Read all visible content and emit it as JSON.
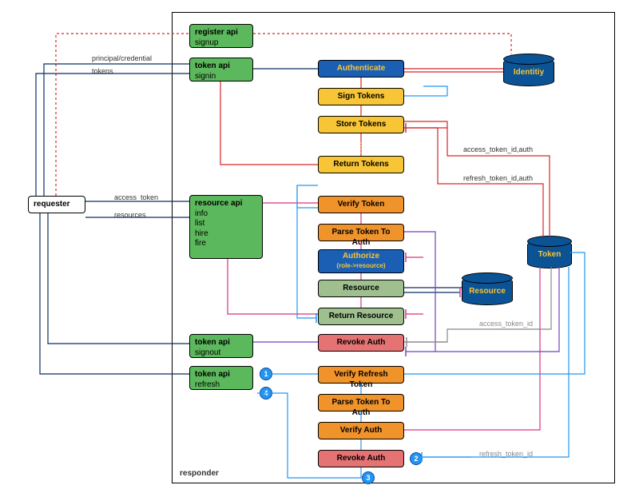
{
  "requester": {
    "label": "requester",
    "edge_out_top": "principal/credential",
    "edge_out_bottom": "tokens",
    "edge_in_top": "access_token",
    "edge_in_bottom": "resources"
  },
  "responder_label": "responder",
  "apis": {
    "register": {
      "title": "register api",
      "sub": "signup"
    },
    "token_signin": {
      "title": "token api",
      "sub": "signin"
    },
    "resource": {
      "title": "resource api",
      "subs": [
        "info",
        "list",
        "hire",
        "fire"
      ]
    },
    "token_signout": {
      "title": "token api",
      "sub": "signout"
    },
    "token_refresh": {
      "title": "token api",
      "sub": "refresh"
    }
  },
  "pipeline": {
    "authenticate": "Authenticate",
    "sign_tokens": "Sign Tokens",
    "store_tokens": "Store Tokens",
    "return_tokens": "Return Tokens",
    "verify_token": "Verify Token",
    "parse_token": "Parse Token To Auth",
    "authorize": {
      "title": "Authorize",
      "sub": "(role->resource)"
    },
    "resource": "Resource",
    "return_resource": "Return Resource",
    "revoke_auth_1": "Revoke Auth",
    "verify_refresh": "Verify Refresh Token",
    "parse_token_2": "Parse Token To Auth",
    "verify_auth": "Verify Auth",
    "revoke_auth_2": "Revoke Auth"
  },
  "stores": {
    "identity": "Identitiy",
    "token": "Token",
    "resource": "Resource"
  },
  "annotations": {
    "access_token_id_auth": "access_token_id,auth",
    "refresh_token_id_auth": "refresh_token_id,auth",
    "access_token_id": "access_token_id",
    "refresh_token_id": "refresh_token_id"
  },
  "badges": {
    "b1": "1",
    "b2": "2",
    "b3": "3",
    "b4": "4"
  },
  "colors": {
    "arrow_navy": "#0b2e63",
    "arrow_red": "#d62728",
    "arrow_skyblue": "#2196f3",
    "arrow_orange": "#f0932b",
    "arrow_magenta": "#d63384",
    "arrow_violet": "#6f42c1",
    "arrow_gray": "#888"
  }
}
